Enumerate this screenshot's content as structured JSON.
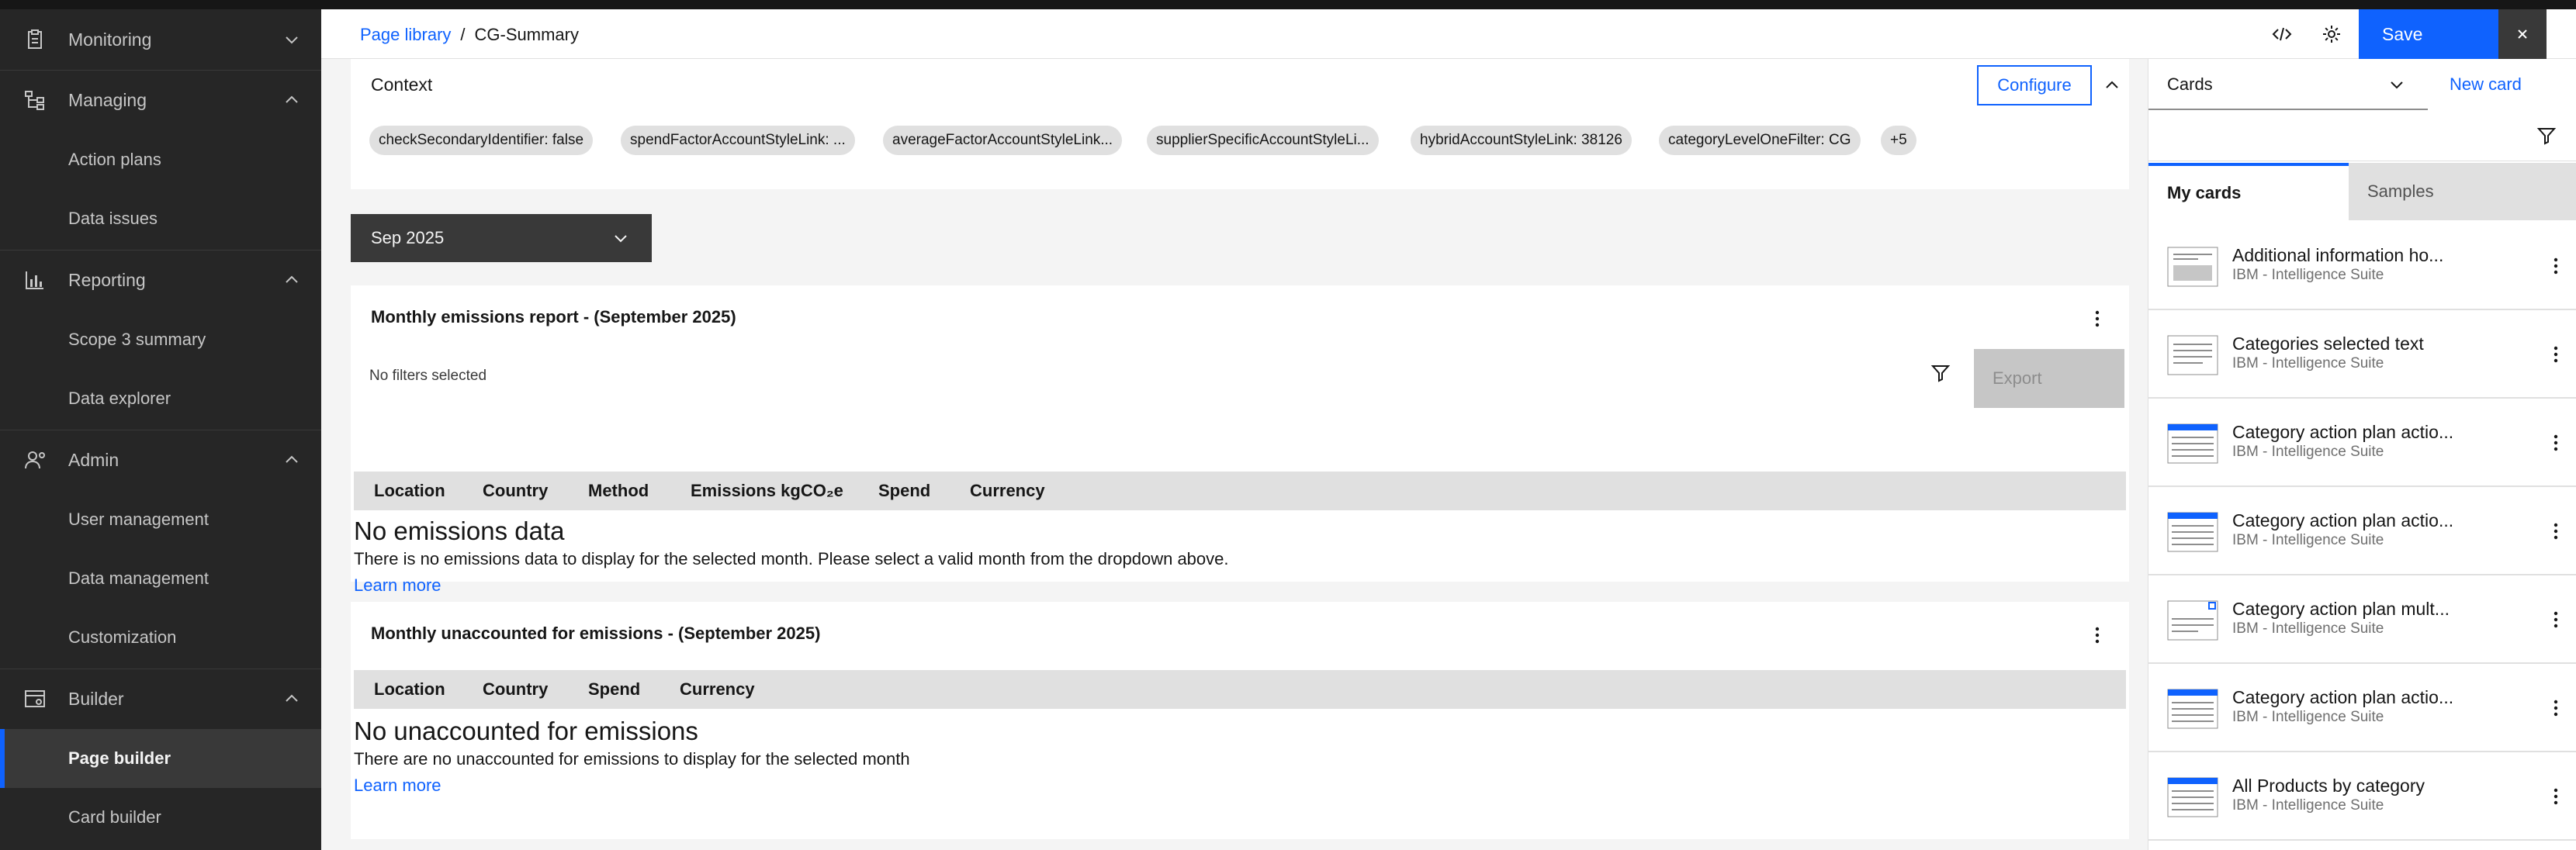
{
  "sidebar": {
    "groups": {
      "monitoring": "Monitoring",
      "managing": "Managing",
      "reporting": "Reporting",
      "admin": "Admin",
      "builder": "Builder"
    },
    "items": {
      "action_plans": "Action plans",
      "data_issues": "Data issues",
      "scope3": "Scope 3 summary",
      "data_explorer": "Data explorer",
      "user_mgmt": "User management",
      "data_mgmt": "Data management",
      "customization": "Customization",
      "page_builder": "Page builder",
      "card_builder": "Card builder"
    }
  },
  "header": {
    "breadcrumb_link": "Page library",
    "breadcrumb_sep": "/",
    "breadcrumb_current": "CG-Summary",
    "save_label": "Save"
  },
  "context": {
    "title": "Context",
    "configure_label": "Configure",
    "tags": [
      "checkSecondaryIdentifier: false",
      "spendFactorAccountStyleLink: ...",
      "averageFactorAccountStyleLink...",
      "supplierSpecificAccountStyleLi...",
      "hybridAccountStyleLink: 38126",
      "categoryLevelOneFilter: CG",
      "+5"
    ]
  },
  "month_select": {
    "value": "Sep 2025"
  },
  "emissions_card": {
    "title": "Monthly emissions report - (September 2025)",
    "filter_status": "No filters selected",
    "export_label": "Export",
    "columns": [
      "Location",
      "Country",
      "Method",
      "Emissions kgCO₂e",
      "Spend",
      "Currency"
    ],
    "empty_title": "No emissions data",
    "empty_body": "There is no emissions data to display for the selected month. Please select a valid month from the dropdown above.",
    "learn_more": "Learn more"
  },
  "unaccounted_card": {
    "title": "Monthly unaccounted for emissions - (September 2025)",
    "columns": [
      "Location",
      "Country",
      "Spend",
      "Currency"
    ],
    "empty_title": "No unaccounted for emissions",
    "empty_body": "There are no unaccounted for emissions to display for the selected month",
    "learn_more": "Learn more"
  },
  "right_panel": {
    "select_value": "Cards",
    "new_card_label": "New card",
    "tabs": {
      "my_cards": "My cards",
      "samples": "Samples"
    },
    "cards": [
      {
        "name": "Additional information ho...",
        "source": "IBM - Intelligence Suite",
        "icon": "text-card-icon"
      },
      {
        "name": "Categories selected text",
        "source": "IBM - Intelligence Suite",
        "icon": "text-card-icon"
      },
      {
        "name": "Category action plan actio...",
        "source": "IBM - Intelligence Suite",
        "icon": "table-card-icon"
      },
      {
        "name": "Category action plan actio...",
        "source": "IBM - Intelligence Suite",
        "icon": "table-card-icon"
      },
      {
        "name": "Category action plan mult...",
        "source": "IBM - Intelligence Suite",
        "icon": "form-card-icon"
      },
      {
        "name": "Category action plan actio...",
        "source": "IBM - Intelligence Suite",
        "icon": "table-card-icon"
      },
      {
        "name": "All Products by category",
        "source": "IBM - Intelligence Suite",
        "icon": "table-card-icon"
      }
    ]
  },
  "colors": {
    "accent": "#0f62fe",
    "sidebar_bg": "#262626",
    "content_bg": "#f4f4f4"
  }
}
